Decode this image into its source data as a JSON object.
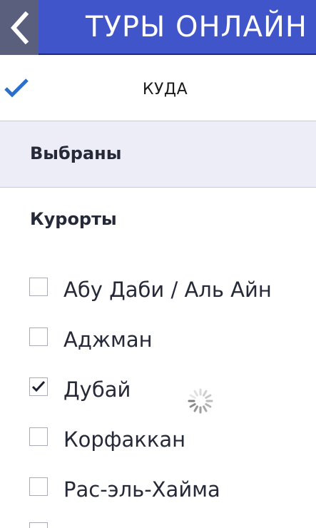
{
  "header": {
    "title": "ТУРЫ ОНЛАЙН",
    "back_icon": "chevron-left-icon",
    "color": "#3f55c9"
  },
  "destination": {
    "label": "КУДА",
    "icon": "checkmark-icon",
    "accent": "#2a6fcb"
  },
  "selected": {
    "label": "Выбраны"
  },
  "resorts": {
    "heading": "Курорты",
    "items": [
      {
        "label": "Абу Даби / Аль Айн",
        "checked": false
      },
      {
        "label": "Аджман",
        "checked": false
      },
      {
        "label": "Дубай",
        "checked": true
      },
      {
        "label": "Корфаккан",
        "checked": false
      },
      {
        "label": "Рас-эль-Хайма",
        "checked": false
      }
    ]
  },
  "loading": {
    "icon": "spinner-icon"
  }
}
